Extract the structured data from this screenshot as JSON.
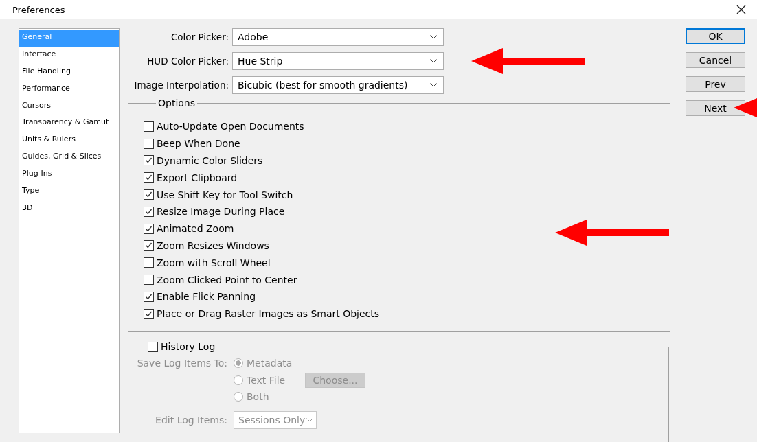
{
  "window": {
    "title": "Preferences"
  },
  "sidebar": {
    "items": [
      {
        "label": "General",
        "selected": true
      },
      {
        "label": "Interface",
        "selected": false
      },
      {
        "label": "File Handling",
        "selected": false
      },
      {
        "label": "Performance",
        "selected": false
      },
      {
        "label": "Cursors",
        "selected": false
      },
      {
        "label": "Transparency & Gamut",
        "selected": false
      },
      {
        "label": "Units & Rulers",
        "selected": false
      },
      {
        "label": "Guides, Grid & Slices",
        "selected": false
      },
      {
        "label": "Plug-Ins",
        "selected": false
      },
      {
        "label": "Type",
        "selected": false
      },
      {
        "label": "3D",
        "selected": false
      }
    ]
  },
  "pickers": [
    {
      "label": "Color Picker:",
      "value": "Adobe"
    },
    {
      "label": "HUD Color Picker:",
      "value": "Hue Strip"
    },
    {
      "label": "Image Interpolation:",
      "value": "Bicubic (best for smooth gradients)"
    }
  ],
  "options": {
    "title": "Options",
    "items": [
      {
        "label": "Auto-Update Open Documents",
        "checked": false
      },
      {
        "label": "Beep When Done",
        "checked": false
      },
      {
        "label": "Dynamic Color Sliders",
        "checked": true
      },
      {
        "label": "Export Clipboard",
        "checked": true
      },
      {
        "label": "Use Shift Key for Tool Switch",
        "checked": true
      },
      {
        "label": "Resize Image During Place",
        "checked": true
      },
      {
        "label": "Animated Zoom",
        "checked": true
      },
      {
        "label": "Zoom Resizes Windows",
        "checked": true
      },
      {
        "label": "Zoom with Scroll Wheel",
        "checked": false
      },
      {
        "label": "Zoom Clicked Point to Center",
        "checked": false
      },
      {
        "label": "Enable Flick Panning",
        "checked": true
      },
      {
        "label": "Place or Drag Raster Images as Smart Objects",
        "checked": true
      }
    ]
  },
  "history_log": {
    "label": "History Log",
    "checked": false,
    "disabled": true,
    "save_to_label": "Save Log Items To:",
    "save_options": [
      {
        "label": "Metadata",
        "selected": true
      },
      {
        "label": "Text File",
        "selected": false,
        "button": "Choose..."
      },
      {
        "label": "Both",
        "selected": false
      }
    ],
    "edit_label": "Edit Log Items:",
    "edit_value": "Sessions Only"
  },
  "buttons": [
    {
      "label": "OK",
      "default": true
    },
    {
      "label": "Cancel",
      "default": false
    },
    {
      "label": "Prev",
      "default": false
    },
    {
      "label": "Next",
      "default": false
    }
  ]
}
